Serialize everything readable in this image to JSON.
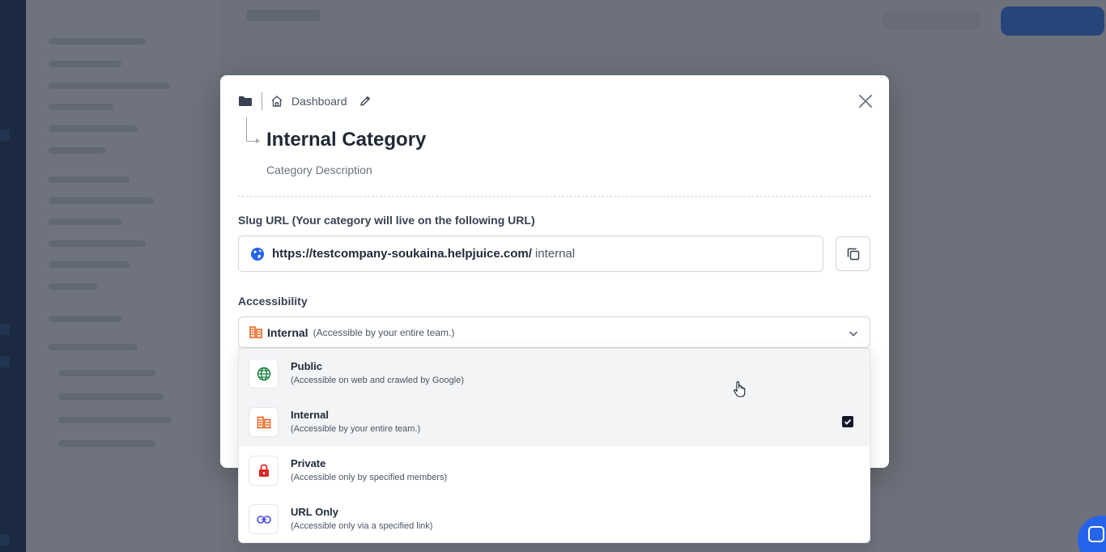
{
  "breadcrumb": {
    "label": "Dashboard"
  },
  "category": {
    "title": "Internal Category",
    "description": "Category Description"
  },
  "slug": {
    "label": "Slug URL (Your category will live on the following URL)",
    "base_url": "https://testcompany-soukaina.helpjuice.com/",
    "value": "internal"
  },
  "accessibility": {
    "label": "Accessibility",
    "selected": {
      "name": "Internal",
      "description": "(Accessible by your entire team.)"
    },
    "options": [
      {
        "name": "Public",
        "description": "(Accessible on web and crawled by Google)",
        "icon": "globe-icon",
        "color": "#15803d"
      },
      {
        "name": "Internal",
        "description": "(Accessible by your entire team.)",
        "icon": "building-icon",
        "color": "#ea580c",
        "checked": true
      },
      {
        "name": "Private",
        "description": "(Accessible only by specified members)",
        "icon": "lock-icon",
        "color": "#dc2626"
      },
      {
        "name": "URL Only",
        "description": "(Accessible only via a specified link)",
        "icon": "link-icon",
        "color": "#4f46e5"
      }
    ]
  },
  "colors": {
    "accent": "#2563eb",
    "overlay": "rgba(26,32,46,0.62)",
    "check": "#111827"
  }
}
